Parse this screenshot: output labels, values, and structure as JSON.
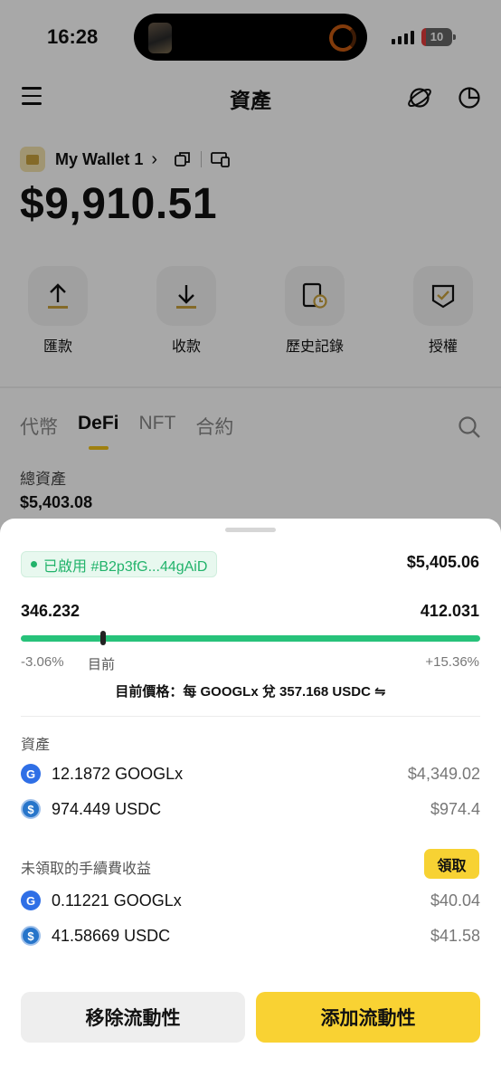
{
  "status_bar": {
    "time": "16:28",
    "battery": "10"
  },
  "header": {
    "title": "資產"
  },
  "wallet": {
    "name": "My Wallet 1",
    "arrow": "›",
    "balance": "$9,910.51"
  },
  "actions": [
    {
      "label": "匯款",
      "icon": "upload-icon"
    },
    {
      "label": "收款",
      "icon": "download-icon"
    },
    {
      "label": "歷史記錄",
      "icon": "history-icon"
    },
    {
      "label": "授權",
      "icon": "shield-check-icon"
    }
  ],
  "tabs": [
    {
      "label": "代幣",
      "active": false
    },
    {
      "label": "DeFi",
      "active": true
    },
    {
      "label": "NFT",
      "active": false
    },
    {
      "label": "合約",
      "active": false
    }
  ],
  "total": {
    "label": "總資產",
    "value": "$5,403.08"
  },
  "sheet": {
    "position_tag": "已啟用 #B2p3fG...44gAiD",
    "position_value": "$5,405.06",
    "range_low": "346.232",
    "range_high": "412.031",
    "range_marker_fraction": 0.18,
    "pct_low": "-3.06%",
    "now_label": "目前",
    "pct_high": "+15.36%",
    "price_line": "目前價格：每 GOOGLx 兌 357.168 USDC ⇋",
    "assets_label": "資產",
    "assets": [
      {
        "coin": "G",
        "amount": "12.1872 GOOGLx",
        "usd": "$4,349.02"
      },
      {
        "coin": "$",
        "amount": "974.449 USDC",
        "usd": "$974.4"
      }
    ],
    "fees_label": "未領取的手續費收益",
    "claim_label": "領取",
    "fees": [
      {
        "coin": "G",
        "amount": "0.11221 GOOGLx",
        "usd": "$40.04"
      },
      {
        "coin": "$",
        "amount": "41.58669 USDC",
        "usd": "$41.58"
      }
    ],
    "remove_label": "移除流動性",
    "add_label": "添加流動性"
  },
  "colors": {
    "accent": "#f9d233",
    "range_bar": "#27c27a",
    "tag_green": "#22b36b"
  }
}
